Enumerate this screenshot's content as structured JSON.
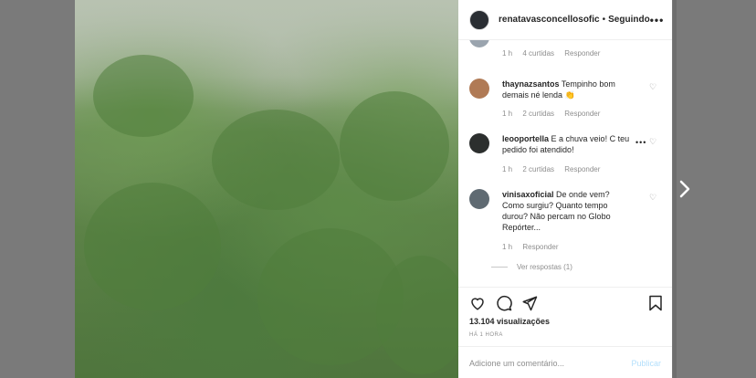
{
  "header": {
    "username": "renatavasconcellosofic",
    "separator": "•",
    "follow_status": "Seguindo",
    "more": "•••"
  },
  "comments": [
    {
      "user": "",
      "text": "",
      "time": "1 h",
      "likes": "4 curtidas",
      "reply": "Responder",
      "avatar_color": "#9aa4ae"
    },
    {
      "user": "thaynazsantos",
      "text": "Tempinho bom demais né lenda 👏",
      "time": "1 h",
      "likes": "2 curtidas",
      "reply": "Responder",
      "avatar_color": "#b07a55"
    },
    {
      "user": "leooportella",
      "text": "E a chuva veio! C teu pedido foi atendido!",
      "time": "1 h",
      "likes": "2 curtidas",
      "reply": "Responder",
      "more": "•••",
      "avatar_color": "#2c2f2e"
    },
    {
      "user": "vinisaxoficial",
      "text": "De onde vem? Como surgiu? Quanto tempo durou? Não percam no Globo Repórter...",
      "time": "1 h",
      "reply": "Responder",
      "avatar_color": "#5f6a72"
    }
  ],
  "view_replies": "Ver respostas (1)",
  "actions": {
    "icons": [
      "heart-icon",
      "comment-icon",
      "share-icon",
      "bookmark-icon"
    ]
  },
  "views": "13.104 visualizações",
  "posted": "HÁ 1 HORA",
  "add_comment": {
    "placeholder": "Adicione um comentário...",
    "publish_label": "Publicar"
  },
  "colors": {
    "text": "#262626",
    "secondary": "#8e8e8e",
    "publish_disabled": "#b2dffc",
    "backdrop": "#7a7a7a"
  }
}
